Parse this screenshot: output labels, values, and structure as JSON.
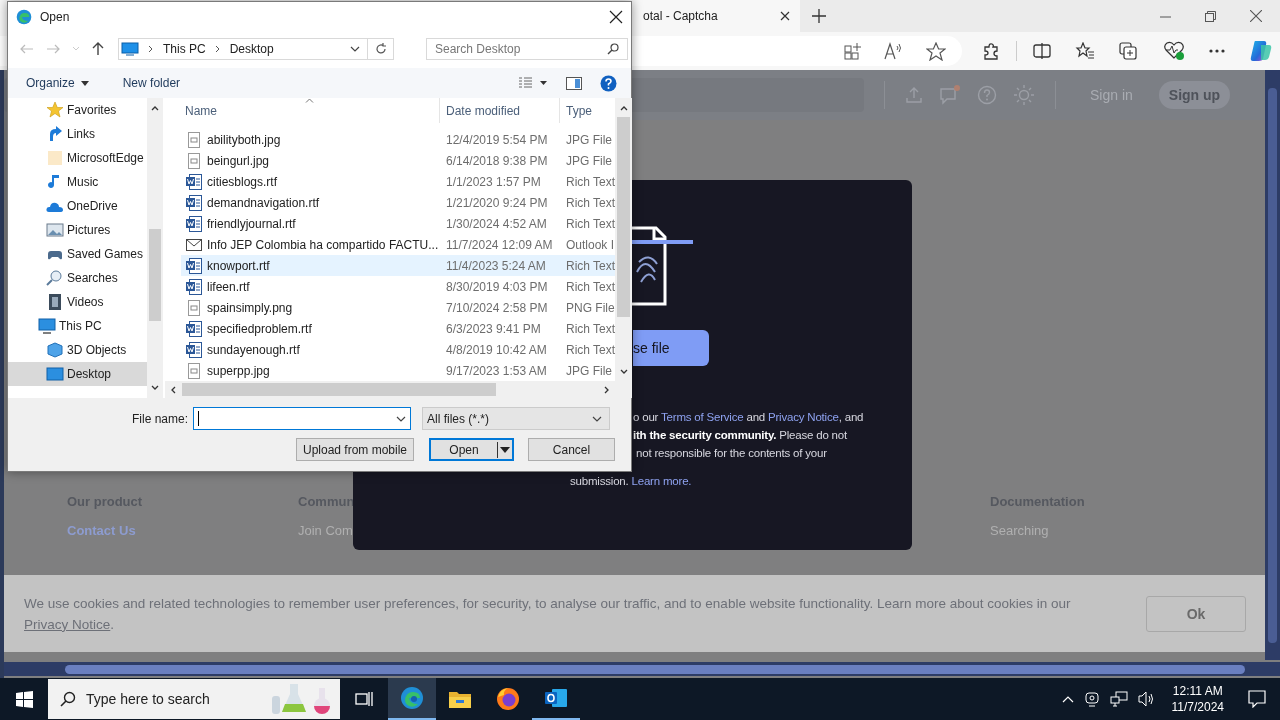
{
  "browser": {
    "tab_title": "otal - Captcha",
    "page_header": {
      "sign_in": "Sign in",
      "sign_up": "Sign up"
    },
    "modal": {
      "button": "se file",
      "lines": [
        [
          {
            "kind": "plain",
            "text": "o our "
          },
          {
            "kind": "link",
            "text": "Terms of Service"
          },
          {
            "kind": "plain",
            "text": " and "
          },
          {
            "kind": "link",
            "text": "Privacy Notice"
          },
          {
            "kind": "plain",
            "text": ", and"
          }
        ],
        [
          {
            "kind": "bold",
            "text": "ith the security community."
          },
          {
            "kind": "plain",
            "text": " Please do not"
          }
        ],
        [
          {
            "kind": "plain",
            "text": "not responsible for the contents of your"
          }
        ],
        [
          {
            "kind": "plain",
            "text": "submission. "
          },
          {
            "kind": "link",
            "text": "Learn more."
          }
        ]
      ]
    },
    "footer": [
      {
        "heading": "Our product",
        "links": [
          {
            "text": "Contact Us",
            "highlighted": true
          }
        ]
      },
      {
        "heading": "Commun",
        "links": [
          {
            "text": "Join Com",
            "highlighted": false
          }
        ]
      },
      {
        "heading": "Documentation",
        "links": [
          {
            "text": "Searching",
            "highlighted": false
          }
        ]
      }
    ],
    "cookie_banner": {
      "text": "We use cookies and related technologies to remember user preferences, for security, to analyse our traffic, and to enable website functionality. Learn more about cookies in our ",
      "link": "Privacy Notice",
      "after": ".",
      "button": "Ok"
    }
  },
  "dialog": {
    "title": "Open",
    "path": [
      "This PC",
      "Desktop"
    ],
    "search_placeholder": "Search Desktop",
    "organize": "Organize",
    "new_folder": "New folder",
    "nav": [
      {
        "label": "Favorites",
        "kind": "star",
        "selected": false
      },
      {
        "label": "Links",
        "kind": "link",
        "selected": false
      },
      {
        "label": "MicrosoftEdge",
        "kind": "folder",
        "selected": false
      },
      {
        "label": "Music",
        "kind": "music",
        "selected": false
      },
      {
        "label": "OneDrive",
        "kind": "cloud",
        "selected": false
      },
      {
        "label": "Pictures",
        "kind": "pictures",
        "selected": false
      },
      {
        "label": "Saved Games",
        "kind": "games",
        "selected": false
      },
      {
        "label": "Searches",
        "kind": "search",
        "selected": false
      },
      {
        "label": "Videos",
        "kind": "video",
        "selected": false
      },
      {
        "label": "This PC",
        "kind": "pc",
        "selected": false,
        "children": [
          {
            "label": "3D Objects",
            "kind": "cube",
            "selected": false
          },
          {
            "label": "Desktop",
            "kind": "desktop",
            "selected": true
          }
        ]
      }
    ],
    "columns": [
      "Name",
      "Date modified",
      "Type"
    ],
    "files": [
      {
        "name": "abilityboth.jpg",
        "date": "12/4/2019 5:54 PM",
        "type": "JPG File",
        "kind": "image",
        "selected": false
      },
      {
        "name": "beingurl.jpg",
        "date": "6/14/2018 9:38 PM",
        "type": "JPG File",
        "kind": "image",
        "selected": false
      },
      {
        "name": "citiesblogs.rtf",
        "date": "1/1/2023 1:57 PM",
        "type": "Rich Text",
        "kind": "doc",
        "selected": false
      },
      {
        "name": "demandnavigation.rtf",
        "date": "1/21/2020 9:24 PM",
        "type": "Rich Text",
        "kind": "doc",
        "selected": false
      },
      {
        "name": "friendlyjournal.rtf",
        "date": "1/30/2024 4:52 AM",
        "type": "Rich Text",
        "kind": "doc",
        "selected": false
      },
      {
        "name": "Info JEP Colombia ha compartido FACTU...",
        "date": "11/7/2024 12:09 AM",
        "type": "Outlook I",
        "kind": "mail",
        "selected": false
      },
      {
        "name": "knowport.rtf",
        "date": "11/4/2023 5:24 AM",
        "type": "Rich Text",
        "kind": "doc",
        "selected": true
      },
      {
        "name": "lifeen.rtf",
        "date": "8/30/2019 4:03 PM",
        "type": "Rich Text",
        "kind": "doc",
        "selected": false
      },
      {
        "name": "spainsimply.png",
        "date": "7/10/2024 2:58 PM",
        "type": "PNG File",
        "kind": "image",
        "selected": false
      },
      {
        "name": "specifiedproblem.rtf",
        "date": "6/3/2023 9:41 PM",
        "type": "Rich Text",
        "kind": "doc",
        "selected": false
      },
      {
        "name": "sundayenough.rtf",
        "date": "4/8/2019 10:42 AM",
        "type": "Rich Text",
        "kind": "doc",
        "selected": false
      },
      {
        "name": "superpp.jpg",
        "date": "9/17/2023 1:53 AM",
        "type": "JPG File",
        "kind": "image",
        "selected": false
      }
    ],
    "file_name_label": "File name:",
    "filter": "All files (*.*)",
    "buttons": {
      "upload": "Upload from mobile",
      "open": "Open",
      "cancel": "Cancel"
    }
  },
  "taskbar": {
    "search_placeholder": "Type here to search",
    "apps": [
      {
        "kind": "taskview",
        "active": false,
        "running": false
      },
      {
        "kind": "edge",
        "active": true,
        "running": true
      },
      {
        "kind": "explorer",
        "active": false,
        "running": false
      },
      {
        "kind": "firefox",
        "active": false,
        "running": false
      },
      {
        "kind": "outlook",
        "active": false,
        "running": true
      }
    ],
    "time": "12:11 AM",
    "date": "11/7/2024"
  }
}
